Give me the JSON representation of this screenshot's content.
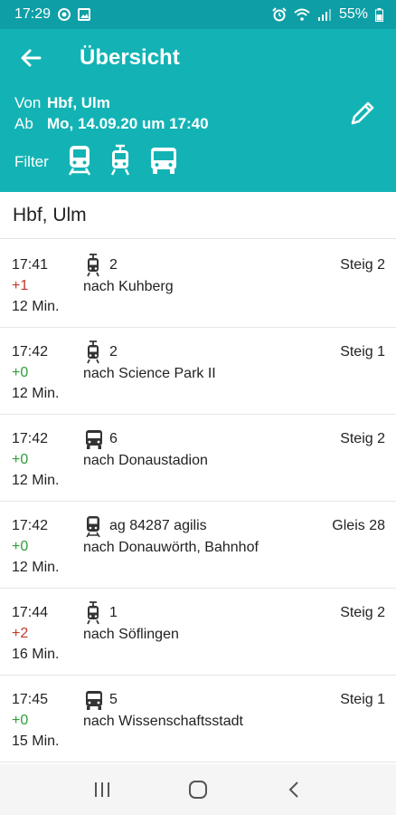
{
  "status_bar": {
    "time": "17:29",
    "battery": "55%"
  },
  "header": {
    "title": "Übersicht",
    "from_label": "Von",
    "from_value": "Hbf, Ulm",
    "departure_label": "Ab",
    "departure_value": "Mo, 14.09.20 um 17:40",
    "filter_label": "Filter",
    "filter_icons": [
      "train-icon",
      "tram-icon",
      "bus-icon"
    ]
  },
  "station": "Hbf, Ulm",
  "departures": [
    {
      "time": "17:41",
      "delay": "+1",
      "minutes": "12 Min.",
      "vehicle": "tram-icon",
      "line": "2",
      "destination": "nach Kuhberg",
      "platform": "Steig 2"
    },
    {
      "time": "17:42",
      "delay": "+0",
      "minutes": "12 Min.",
      "vehicle": "tram-icon",
      "line": "2",
      "destination": "nach Science Park II",
      "platform": "Steig 1"
    },
    {
      "time": "17:42",
      "delay": "+0",
      "minutes": "12 Min.",
      "vehicle": "bus-icon",
      "line": "6",
      "destination": "nach Donaustadion",
      "platform": "Steig 2"
    },
    {
      "time": "17:42",
      "delay": "+0",
      "minutes": "12 Min.",
      "vehicle": "train-icon",
      "line": "ag 84287 agilis",
      "destination": "nach Donauwörth, Bahnhof",
      "platform": "Gleis 28"
    },
    {
      "time": "17:44",
      "delay": "+2",
      "minutes": "16 Min.",
      "vehicle": "tram-icon",
      "line": "1",
      "destination": "nach Söflingen",
      "platform": "Steig 2"
    },
    {
      "time": "17:45",
      "delay": "+0",
      "minutes": "15 Min.",
      "vehicle": "bus-icon",
      "line": "5",
      "destination": "nach Wissenschaftsstadt",
      "platform": "Steig 1"
    }
  ],
  "colors": {
    "header": "#13b3b5",
    "statusbar": "#0e9ea6",
    "delay_positive": "#c0392b",
    "delay_zero": "#2e9e3b"
  },
  "nav_icons": [
    "recent-apps-icon",
    "home-icon",
    "back-icon"
  ]
}
